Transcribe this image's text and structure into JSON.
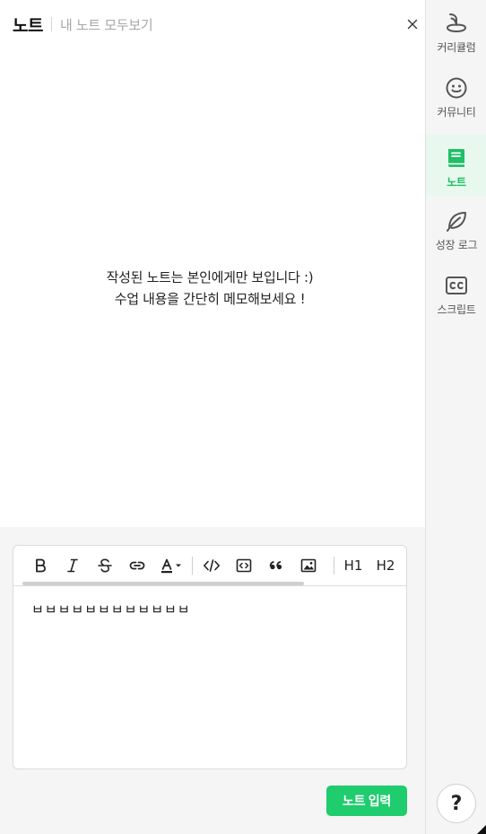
{
  "header": {
    "title": "노트",
    "view_all": "내 노트 모두보기"
  },
  "empty_state": {
    "line1": "작성된 노트는 본인에게만 보입니다 :)",
    "line2": "수업 내용을 간단히 메모해보세요 !"
  },
  "toolbar": {
    "buttons": [
      "bold",
      "italic",
      "strikethrough",
      "link",
      "text-color",
      "code",
      "code-block",
      "quote",
      "image"
    ],
    "h1": "H1",
    "h2": "H2"
  },
  "editor": {
    "content": "ㅂㅂㅂㅂㅂㅂㅂㅂㅂㅂㅂㅂ"
  },
  "submit_label": "노트 입력",
  "sidebar": {
    "items": [
      {
        "label": "커리큘럼",
        "icon": "curriculum-icon"
      },
      {
        "label": "커뮤니티",
        "icon": "community-icon"
      },
      {
        "label": "노트",
        "icon": "note-icon",
        "active": true
      },
      {
        "label": "성장 로그",
        "icon": "leaf-icon"
      },
      {
        "label": "스크립트",
        "icon": "cc-icon"
      }
    ]
  },
  "help_label": "?",
  "colors": {
    "accent": "#1fcc6e",
    "sidebar_bg": "#f5f5f5"
  }
}
